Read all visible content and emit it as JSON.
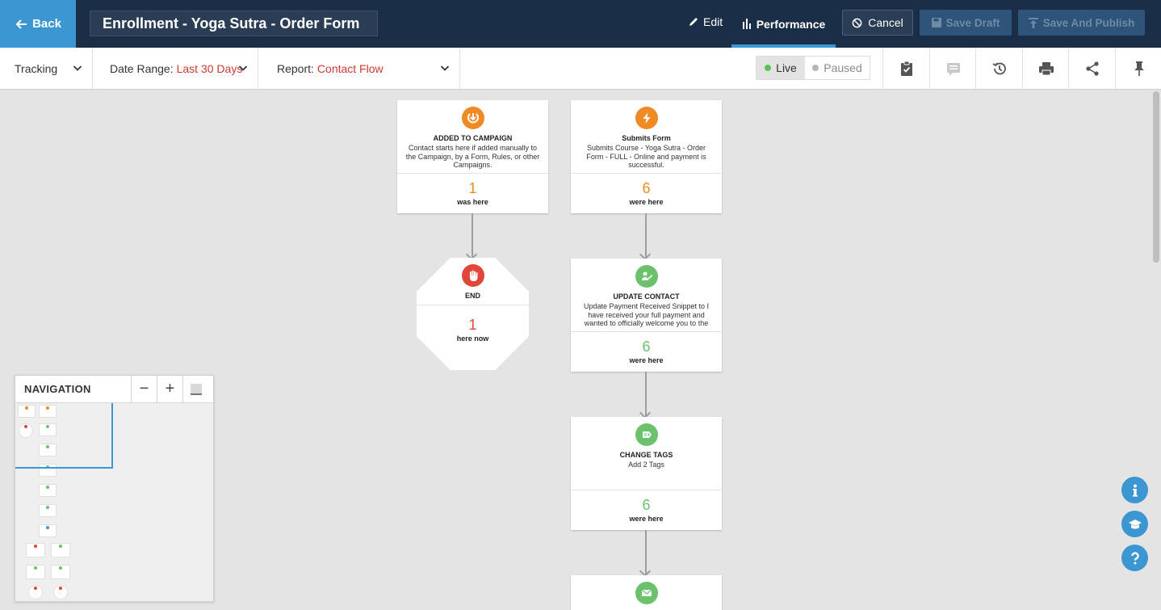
{
  "header": {
    "back_label": "Back",
    "campaign_title": "Enrollment - Yoga Sutra - Order Form",
    "edit_label": "Edit",
    "performance_label": "Performance",
    "cancel_label": "Cancel",
    "save_draft_label": "Save Draft",
    "save_publish_label": "Save And Publish"
  },
  "toolbar": {
    "tracking_label": "Tracking",
    "date_range_label": "Date Range:",
    "date_range_value": "Last 30 Days",
    "report_label": "Report:",
    "report_value": "Contact Flow",
    "live_label": "Live",
    "paused_label": "Paused"
  },
  "flow": {
    "added": {
      "title": "ADDED TO CAMPAIGN",
      "desc": "Contact starts here if added manually to the Campaign, by a Form, Rules, or other Campaigns.",
      "count": "1",
      "label": "was here"
    },
    "submits": {
      "title": "Submits Form",
      "desc": "Submits Course - Yoga Sutra - Order Form - FULL - Online and payment is successful.",
      "count": "6",
      "label": "were here"
    },
    "end": {
      "title": "END",
      "count": "1",
      "label": "here now"
    },
    "update": {
      "title": "UPDATE CONTACT",
      "desc": "Update Payment Received Snippet to I have received your full payment and wanted to officially welcome you to the",
      "count": "6",
      "label": "were here"
    },
    "tags": {
      "title": "CHANGE TAGS",
      "desc": "Add 2 Tags",
      "count": "6",
      "label": "were here"
    }
  },
  "navigation": {
    "title": "NAVIGATION",
    "zoom_out": "−",
    "zoom_in": "+"
  },
  "colors": {
    "topbar": "#1b2e47",
    "accent_blue": "#3b96d1",
    "orange": "#f08a24",
    "red": "#e0463a",
    "green": "#6cc16c"
  }
}
